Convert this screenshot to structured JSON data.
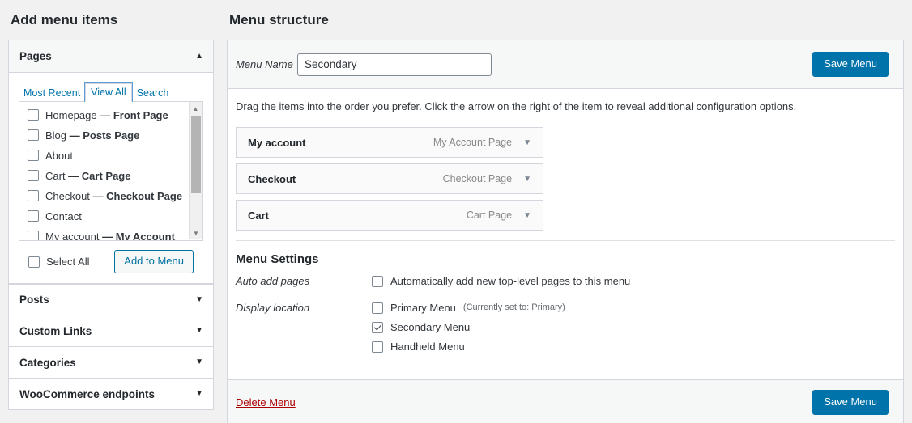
{
  "left": {
    "title": "Add menu items",
    "pages_panel": {
      "header": "Pages",
      "caret": "▲",
      "tabs": [
        {
          "label": "Most Recent",
          "active": false
        },
        {
          "label": "View All",
          "active": true
        },
        {
          "label": "Search",
          "active": false
        }
      ],
      "items": [
        {
          "label": "Homepage",
          "suffix": " — Front Page",
          "checked": false
        },
        {
          "label": "Blog",
          "suffix": " — Posts Page",
          "checked": false
        },
        {
          "label": "About",
          "suffix": "",
          "checked": false
        },
        {
          "label": "Cart",
          "suffix": " — Cart Page",
          "checked": false
        },
        {
          "label": "Checkout",
          "suffix": " — Checkout Page",
          "checked": false
        },
        {
          "label": "Contact",
          "suffix": "",
          "checked": false
        },
        {
          "label": "My account",
          "suffix": " — My Account Page",
          "checked": false
        }
      ],
      "select_all_label": "Select All",
      "add_button": "Add to Menu"
    },
    "collapsed_panels": [
      {
        "label": "Posts",
        "caret": "▼"
      },
      {
        "label": "Custom Links",
        "caret": "▼"
      },
      {
        "label": "Categories",
        "caret": "▼"
      },
      {
        "label": "WooCommerce endpoints",
        "caret": "▼"
      }
    ]
  },
  "right": {
    "title": "Menu structure",
    "menu_name_label": "Menu Name",
    "menu_name_value": "Secondary",
    "menu_name_placeholder": "Menu Name",
    "save_label_top": "Save Menu",
    "save_label_bottom": "Save Menu",
    "hint": "Drag the items into the order you prefer. Click the arrow on the right of the item to reveal additional configuration options.",
    "menu_items": [
      {
        "title": "My account",
        "type": "My Account Page",
        "caret": "▼"
      },
      {
        "title": "Checkout",
        "type": "Checkout Page",
        "caret": "▼"
      },
      {
        "title": "Cart",
        "type": "Cart Page",
        "caret": "▼"
      }
    ],
    "settings": {
      "heading": "Menu Settings",
      "auto_add_label": "Auto add pages",
      "auto_add_option": "Automatically add new top-level pages to this menu",
      "auto_add_checked": false,
      "display_location_label": "Display location",
      "locations": [
        {
          "label": "Primary Menu",
          "note": "(Currently set to: Primary)",
          "checked": false
        },
        {
          "label": "Secondary Menu",
          "note": "",
          "checked": true
        },
        {
          "label": "Handheld Menu",
          "note": "",
          "checked": false
        }
      ]
    },
    "delete_label": "Delete Menu"
  },
  "colors": {
    "accent": "#0073aa",
    "danger": "#a00",
    "page_bg": "#f1f1f1",
    "panel_bg": "#ffffff",
    "header_bg": "#f6f7f7",
    "border": "#d5d5dd"
  }
}
